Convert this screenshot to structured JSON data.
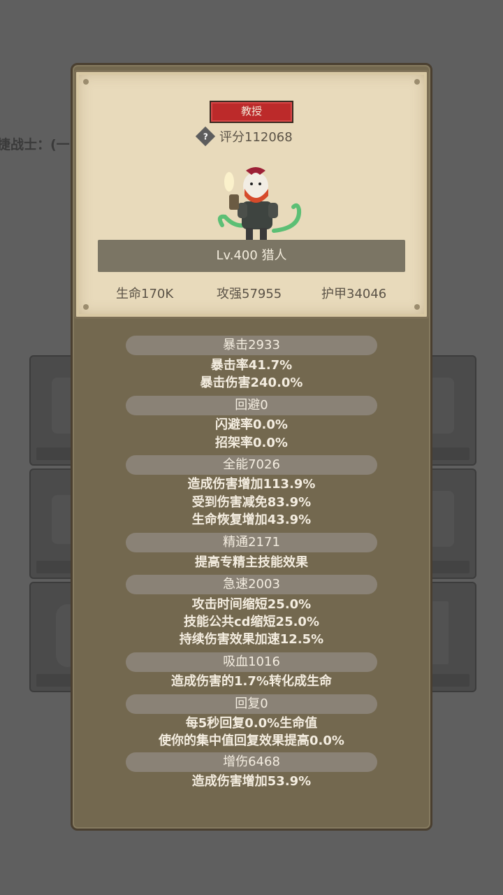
{
  "background": {
    "partial_text": "捷战士：(一"
  },
  "hero": {
    "rank_badge": "教授",
    "rating": "评分112068",
    "level_title": "Lv.400 猎人",
    "stats": {
      "hp": "生命170K",
      "attack": "攻强57955",
      "armor": "护甲34046"
    }
  },
  "attributes": [
    {
      "header": "暴击2933",
      "lines": [
        "暴击率41.7%",
        "暴击伤害240.0%"
      ]
    },
    {
      "header": "回避0",
      "lines": [
        "闪避率0.0%",
        "招架率0.0%"
      ]
    },
    {
      "header": "全能7026",
      "lines": [
        "造成伤害增加113.9%",
        "受到伤害减免83.9%",
        "生命恢复增加43.9%"
      ]
    },
    {
      "header": "精通2171",
      "lines": [
        "提高专精主技能效果"
      ]
    },
    {
      "header": "急速2003",
      "lines": [
        "攻击时间缩短25.0%",
        "技能公共cd缩短25.0%",
        "持续伤害效果加速12.5%"
      ]
    },
    {
      "header": "吸血1016",
      "lines": [
        "造成伤害的1.7%转化成生命"
      ]
    },
    {
      "header": "回复0",
      "lines": [
        "每5秒回复0.0%生命值",
        "使你的集中值回复效果提高0.0%"
      ]
    },
    {
      "header": "增伤6468",
      "lines": [
        "造成伤害增加53.9%"
      ]
    }
  ],
  "colors": {
    "badge": "#bc2a2a",
    "parchment": "#e8dabb",
    "panel": "#73684f"
  }
}
